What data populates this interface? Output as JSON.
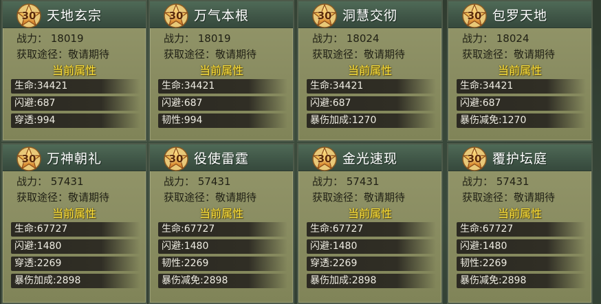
{
  "cards": [
    {
      "badge": "30",
      "title": "天地玄宗",
      "power": "战力：  18019",
      "source": "获取途径：敬请期待",
      "heading": "当前属性",
      "stats": [
        "生命:34421",
        "闪避:687",
        "穿透:994"
      ]
    },
    {
      "badge": "30",
      "title": "万气本根",
      "power": "战力：  18019",
      "source": "获取途径：敬请期待",
      "heading": "当前属性",
      "stats": [
        "生命:34421",
        "闪避:687",
        "韧性:994"
      ]
    },
    {
      "badge": "30",
      "title": "洞慧交彻",
      "power": "战力：  18024",
      "source": "获取途径：敬请期待",
      "heading": "当前属性",
      "stats": [
        "生命:34421",
        "闪避:687",
        "暴伤加成:1270"
      ]
    },
    {
      "badge": "30",
      "title": "包罗天地",
      "power": "战力：  18024",
      "source": "获取途径：敬请期待",
      "heading": "当前属性",
      "stats": [
        "生命:34421",
        "闪避:687",
        "暴伤减免:1270"
      ]
    },
    {
      "badge": "30",
      "title": "万神朝礼",
      "power": "战力：  57431",
      "source": "获取途径：敬请期待",
      "heading": "当前属性",
      "stats": [
        "生命:67727",
        "闪避:1480",
        "穿透:2269",
        "暴伤加成:2898"
      ]
    },
    {
      "badge": "30",
      "title": "役使雷霆",
      "power": "战力：  57431",
      "source": "获取途径：敬请期待",
      "heading": "当前属性",
      "stats": [
        "生命:67727",
        "闪避:1480",
        "韧性:2269",
        "暴伤减免:2898"
      ]
    },
    {
      "badge": "30",
      "title": "金光速现",
      "power": "战力：  57431",
      "source": "获取途径：敬请期待",
      "heading": "当前属性",
      "stats": [
        "生命:67727",
        "闪避:1480",
        "穿透:2269",
        "暴伤加成:2898"
      ]
    },
    {
      "badge": "30",
      "title": "覆护坛庭",
      "power": "战力：  57431",
      "source": "获取途径：敬请期待",
      "heading": "当前属性",
      "stats": [
        "生命:67727",
        "闪避:1480",
        "韧性:2269",
        "暴伤减免:2898"
      ]
    }
  ]
}
